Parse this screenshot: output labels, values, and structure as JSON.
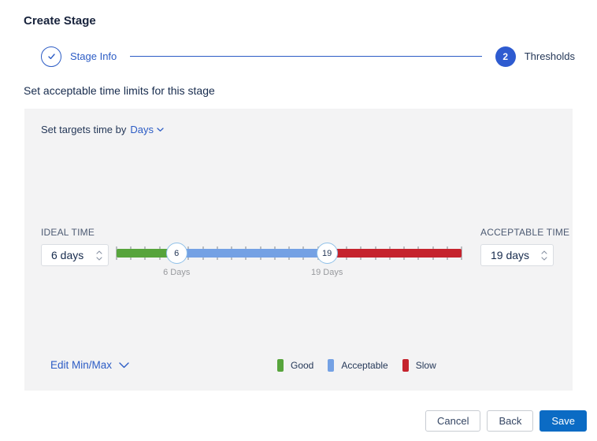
{
  "page": {
    "title": "Create Stage"
  },
  "stepper": {
    "steps": [
      {
        "label": "Stage Info",
        "status": "complete"
      },
      {
        "label": "Thresholds",
        "status": "current",
        "number": "2"
      }
    ]
  },
  "subtitle": "Set acceptable time limits for this stage",
  "panel": {
    "target_prefix": "Set targets time by",
    "target_value": "Days",
    "ideal": {
      "label": "IDEAL TIME",
      "value": "6 days"
    },
    "acceptable": {
      "label": "ACCEPTABLE TIME",
      "value": "19 days"
    },
    "slider": {
      "min_handle": {
        "value": "6",
        "label": "6 Days",
        "pct": 17.4
      },
      "max_handle": {
        "value": "19",
        "label": "19 Days",
        "pct": 61.0
      },
      "tick_count": 25,
      "colors": {
        "good": "#57a43c",
        "acceptable": "#74a1e4",
        "slow": "#c5232d"
      }
    },
    "edit_minmax": "Edit Min/Max",
    "legend": [
      {
        "label": "Good",
        "color": "#57a43c"
      },
      {
        "label": "Acceptable",
        "color": "#74a1e4"
      },
      {
        "label": "Slow",
        "color": "#c5232d"
      }
    ]
  },
  "footer": {
    "cancel": "Cancel",
    "back": "Back",
    "save": "Save"
  },
  "colors": {
    "accent_blue": "#2c5cc5",
    "save_blue": "#0b6bc4"
  }
}
